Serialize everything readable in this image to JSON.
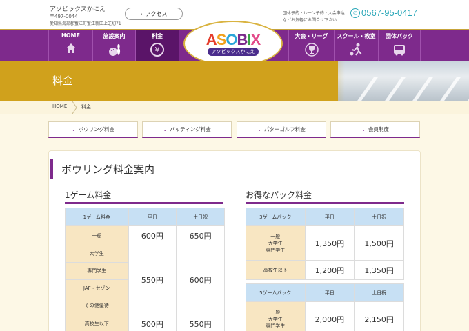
{
  "header": {
    "shop_name": "アソビックスかにえ",
    "zip": "〒497-0044",
    "address": "愛知県海部郡蟹江町蟹江新田上芝切71",
    "access_label": "アクセス",
    "inquiry_line1": "団体予約・レーン予約・大会申込",
    "inquiry_line2": "などお気軽にお問合せ下さい",
    "phone": "0567-95-0417"
  },
  "nav": {
    "left": [
      {
        "label": "HOME",
        "icon": "home-icon"
      },
      {
        "label": "施設案内",
        "icon": "bowling-icon"
      },
      {
        "label": "料金",
        "icon": "yen-icon"
      }
    ],
    "right": [
      {
        "label": "大会・リーグ",
        "icon": "trophy-icon"
      },
      {
        "label": "スクール・教室",
        "icon": "bowler-icon"
      },
      {
        "label": "団体パック",
        "icon": "bus-icon"
      }
    ]
  },
  "logo": {
    "word": "ASOBIX",
    "sub": "アソビックスかにえ"
  },
  "banner": {
    "title": "料金"
  },
  "breadcrumb": {
    "home": "HOME",
    "current": "料金"
  },
  "subtabs": [
    "ボウリング料金",
    "バッティング料金",
    "パターゴルフ料金",
    "会員制度"
  ],
  "main": {
    "heading": "ボウリング料金案内",
    "single_game": {
      "title": "1ゲーム料金",
      "headers": [
        "1ゲーム料金",
        "平日",
        "土日祝"
      ],
      "row1": {
        "cat": "一般",
        "weekday": "600円",
        "weekend": "650円"
      },
      "group_cats": [
        "大学生",
        "専門学生",
        "JAF・セゾン",
        "その他優待"
      ],
      "group_weekday": "550円",
      "group_weekend": "600円",
      "row3": {
        "cat": "高校生以下",
        "weekday": "500円",
        "weekend": "550円"
      }
    },
    "pack": {
      "title": "お得なパック料金",
      "t1_headers": [
        "3ゲームパック",
        "平日",
        "土日祝"
      ],
      "t1_row1": {
        "cat": [
          "一般",
          "大学生",
          "専門学生"
        ],
        "weekday": "1,350円",
        "weekend": "1,500円"
      },
      "t1_row2": {
        "cat": "高校生以下",
        "weekday": "1,200円",
        "weekend": "1,350円"
      },
      "t2_headers": [
        "5ゲームパック",
        "平日",
        "土日祝"
      ],
      "t2_row1": {
        "cat": [
          "一般",
          "大学生",
          "専門学生"
        ],
        "weekday": "2,000円",
        "weekend": "2,150円"
      }
    }
  }
}
